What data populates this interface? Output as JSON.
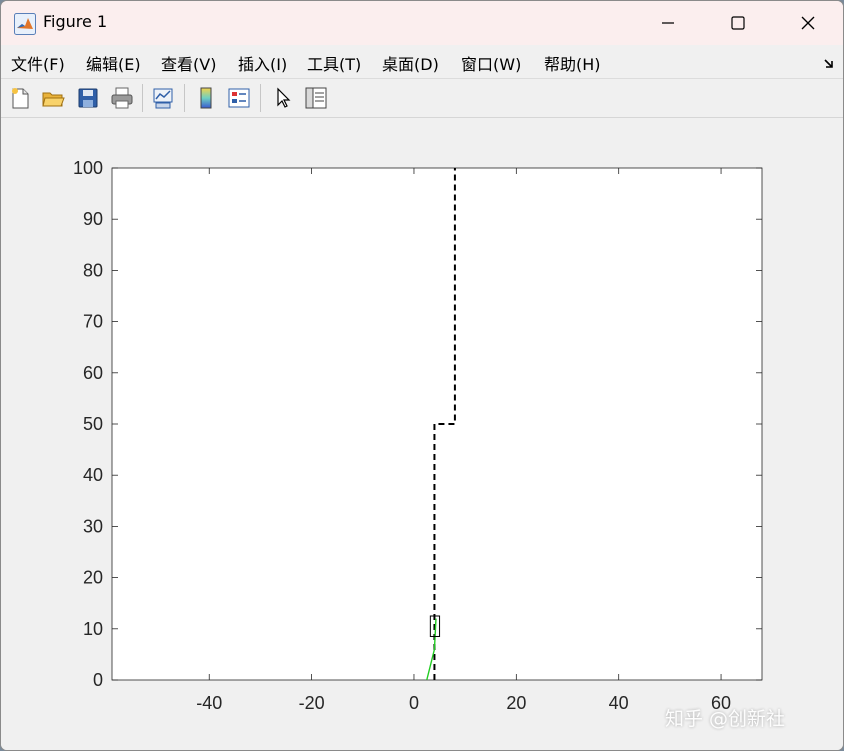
{
  "window": {
    "title": "Figure 1",
    "controls": [
      "minimize-icon",
      "maximize-icon",
      "close-icon"
    ]
  },
  "menu": [
    {
      "label": "文件(F)"
    },
    {
      "label": "编辑(E)"
    },
    {
      "label": "查看(V)"
    },
    {
      "label": "插入(I)"
    },
    {
      "label": "工具(T)"
    },
    {
      "label": "桌面(D)"
    },
    {
      "label": "窗口(W)"
    },
    {
      "label": "帮助(H)"
    }
  ],
  "toolbar": [
    "new-figure-icon",
    "open-file-icon",
    "save-icon",
    "print-icon",
    "link-plot-icon",
    "colorbar-icon",
    "legend-icon",
    "pointer-icon",
    "property-editor-icon"
  ],
  "watermark": "知乎 @创新社",
  "chart_data": {
    "type": "line",
    "title": "",
    "xlabel": "",
    "ylabel": "",
    "xlim": [
      -59,
      68
    ],
    "ylim": [
      0,
      100
    ],
    "xticks": [
      -40,
      -20,
      0,
      20,
      40,
      60
    ],
    "xtick_labels": [
      "-40",
      "-20",
      "0",
      "20",
      "40",
      "60"
    ],
    "yticks": [
      0,
      10,
      20,
      30,
      40,
      50,
      60,
      70,
      80,
      90,
      100
    ],
    "ytick_labels": [
      "0",
      "10",
      "20",
      "30",
      "40",
      "50",
      "60",
      "70",
      "80",
      "90",
      "100"
    ],
    "grid": false,
    "series": [
      {
        "style": "dashed",
        "color": "#000000",
        "x": [
          4,
          4,
          8,
          8
        ],
        "y": [
          0,
          50,
          50,
          100
        ]
      },
      {
        "style": "solid",
        "color": "#22cc22",
        "x": [
          2.5,
          4,
          4.3
        ],
        "y": [
          0,
          6,
          12
        ]
      }
    ],
    "vehicle_box": {
      "x_center": 4.1,
      "y_center": 10.5,
      "width": 1.8,
      "height": 4
    }
  }
}
